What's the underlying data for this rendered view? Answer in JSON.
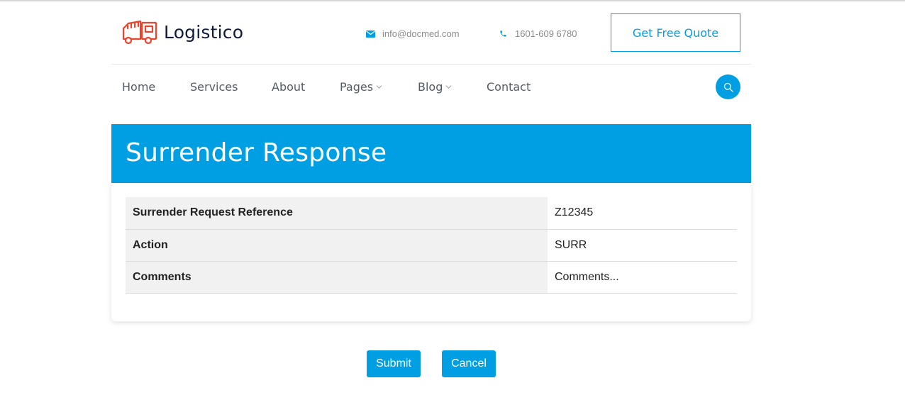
{
  "brand": {
    "name": "Logistico",
    "accent": "#009fe3",
    "logo_color": "#e8452c"
  },
  "header": {
    "email": "info@docmed.com",
    "phone": "1601-609 6780",
    "quote_label": "Get Free Quote"
  },
  "nav": {
    "items": [
      {
        "label": "Home"
      },
      {
        "label": "Services"
      },
      {
        "label": "About"
      },
      {
        "label": "Pages",
        "dropdown": true
      },
      {
        "label": "Blog",
        "dropdown": true
      },
      {
        "label": "Contact"
      }
    ],
    "search_icon": "search-icon"
  },
  "page": {
    "title": "Surrender Response"
  },
  "details": {
    "rows": [
      {
        "label": "Surrender Request Reference",
        "value": "Z12345"
      },
      {
        "label": "Action",
        "value": "SURR"
      },
      {
        "label": "Comments",
        "value": "Comments..."
      }
    ]
  },
  "actions": {
    "submit_label": "Submit",
    "cancel_label": "Cancel"
  }
}
